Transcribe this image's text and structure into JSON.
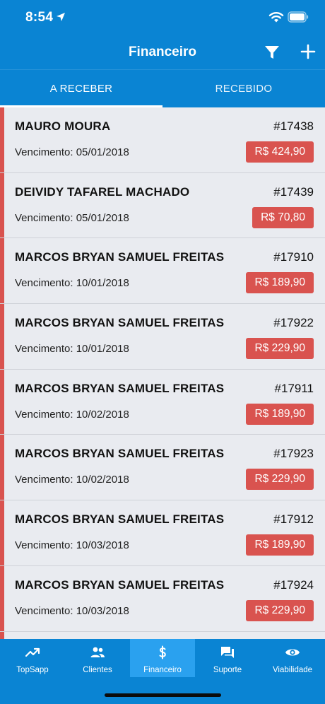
{
  "status_bar": {
    "time": "8:54"
  },
  "nav": {
    "title": "Financeiro"
  },
  "tabs": [
    {
      "label": "A RECEBER",
      "active": true
    },
    {
      "label": "RECEBIDO",
      "active": false
    }
  ],
  "accent_colors": {
    "primary": "#0a84d3",
    "overdue": "#d9534f",
    "active_tab": "#2aa1ef"
  },
  "items": [
    {
      "name": "MAURO MOURA",
      "number": "#17438",
      "due": "Vencimento: 05/01/2018",
      "amount": "R$ 424,90"
    },
    {
      "name": "DEIVIDY TAFAREL MACHADO",
      "number": "#17439",
      "due": "Vencimento: 05/01/2018",
      "amount": "R$ 70,80"
    },
    {
      "name": "MARCOS BRYAN SAMUEL FREITAS",
      "number": "#17910",
      "due": "Vencimento: 10/01/2018",
      "amount": "R$ 189,90"
    },
    {
      "name": "MARCOS BRYAN SAMUEL FREITAS",
      "number": "#17922",
      "due": "Vencimento: 10/01/2018",
      "amount": "R$ 229,90"
    },
    {
      "name": "MARCOS BRYAN SAMUEL FREITAS",
      "number": "#17911",
      "due": "Vencimento: 10/02/2018",
      "amount": "R$ 189,90"
    },
    {
      "name": "MARCOS BRYAN SAMUEL FREITAS",
      "number": "#17923",
      "due": "Vencimento: 10/02/2018",
      "amount": "R$ 229,90"
    },
    {
      "name": "MARCOS BRYAN SAMUEL FREITAS",
      "number": "#17912",
      "due": "Vencimento: 10/03/2018",
      "amount": "R$ 189,90"
    },
    {
      "name": "MARCOS BRYAN SAMUEL FREITAS",
      "number": "#17924",
      "due": "Vencimento: 10/03/2018",
      "amount": "R$ 229,90"
    }
  ],
  "tabbar": [
    {
      "label": "TopSapp",
      "icon": "trending-up-icon",
      "active": false
    },
    {
      "label": "Clientes",
      "icon": "people-icon",
      "active": false
    },
    {
      "label": "Financeiro",
      "icon": "dollar-icon",
      "active": true
    },
    {
      "label": "Suporte",
      "icon": "chat-icon",
      "active": false
    },
    {
      "label": "Viabilidade",
      "icon": "eye-icon",
      "active": false
    }
  ]
}
